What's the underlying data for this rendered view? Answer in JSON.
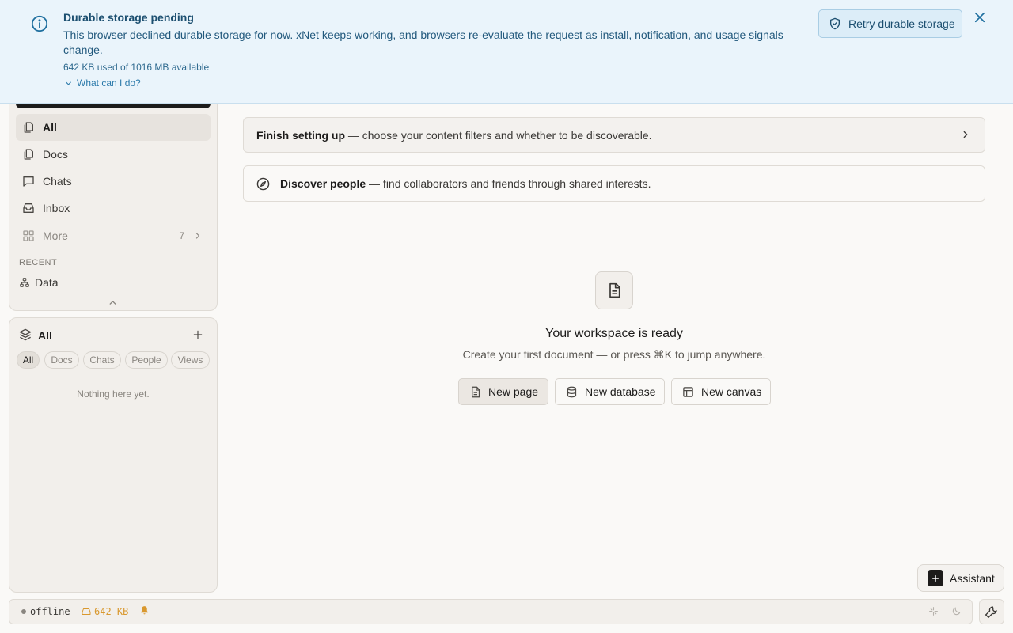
{
  "banner": {
    "title": "Durable storage pending",
    "message": "This browser declined durable storage for now. xNet keeps working, and browsers re-evaluate the request as install, notification, and usage signals change.",
    "usage": "642 KB used of 1016 MB available",
    "what_can_i_do": "What can I do?",
    "retry_label": "Retry durable storage",
    "icons": {
      "info": "info-icon",
      "retry": "shield-check-icon",
      "close": "close-icon"
    }
  },
  "sidebar": {
    "nav": [
      {
        "label": "All",
        "icon": "pages-icon",
        "active": true
      },
      {
        "label": "Docs",
        "icon": "docs-icon",
        "active": false
      },
      {
        "label": "Chats",
        "icon": "chat-icon",
        "active": false
      },
      {
        "label": "Inbox",
        "icon": "inbox-icon",
        "active": false
      }
    ],
    "more": {
      "label": "More",
      "count": "7",
      "icon": "grid-icon"
    },
    "recent_label": "RECENT",
    "recent": [
      {
        "label": "Data",
        "icon": "data-tree-icon"
      }
    ]
  },
  "library": {
    "title": "All",
    "icon": "layers-icon",
    "filters": [
      "All",
      "Docs",
      "Chats",
      "People",
      "Views"
    ],
    "active_filter": "All",
    "empty": "Nothing here yet."
  },
  "main": {
    "setup_card": {
      "bold": "Finish setting up",
      "text": " — choose your content filters and whether to be discoverable."
    },
    "discover_card": {
      "bold": "Discover people",
      "text": " — find collaborators and friends through shared interests.",
      "icon": "compass-icon"
    },
    "empty": {
      "title": "Your workspace is ready",
      "subtitle": "Create your first document — or press ⌘K to jump anywhere.",
      "icon": "document-icon"
    },
    "actions": [
      {
        "label": "New page",
        "icon": "page-icon"
      },
      {
        "label": "New database",
        "icon": "database-icon"
      },
      {
        "label": "New canvas",
        "icon": "canvas-icon"
      }
    ]
  },
  "assistant": {
    "label": "Assistant",
    "icon": "plus-icon"
  },
  "status": {
    "connection": "offline",
    "storage": "642 KB",
    "icons": {
      "storage": "drive-icon",
      "bell": "bell-icon",
      "sparkle": "sparkle-icon",
      "theme": "moon-icon",
      "tools": "wrench-icon"
    }
  },
  "colors": {
    "banner_bg": "#eaf4fb",
    "banner_text": "#1c4f70",
    "app_bg": "#faf9f7",
    "panel_bg": "#f2efeb",
    "warning": "#d9982e"
  }
}
